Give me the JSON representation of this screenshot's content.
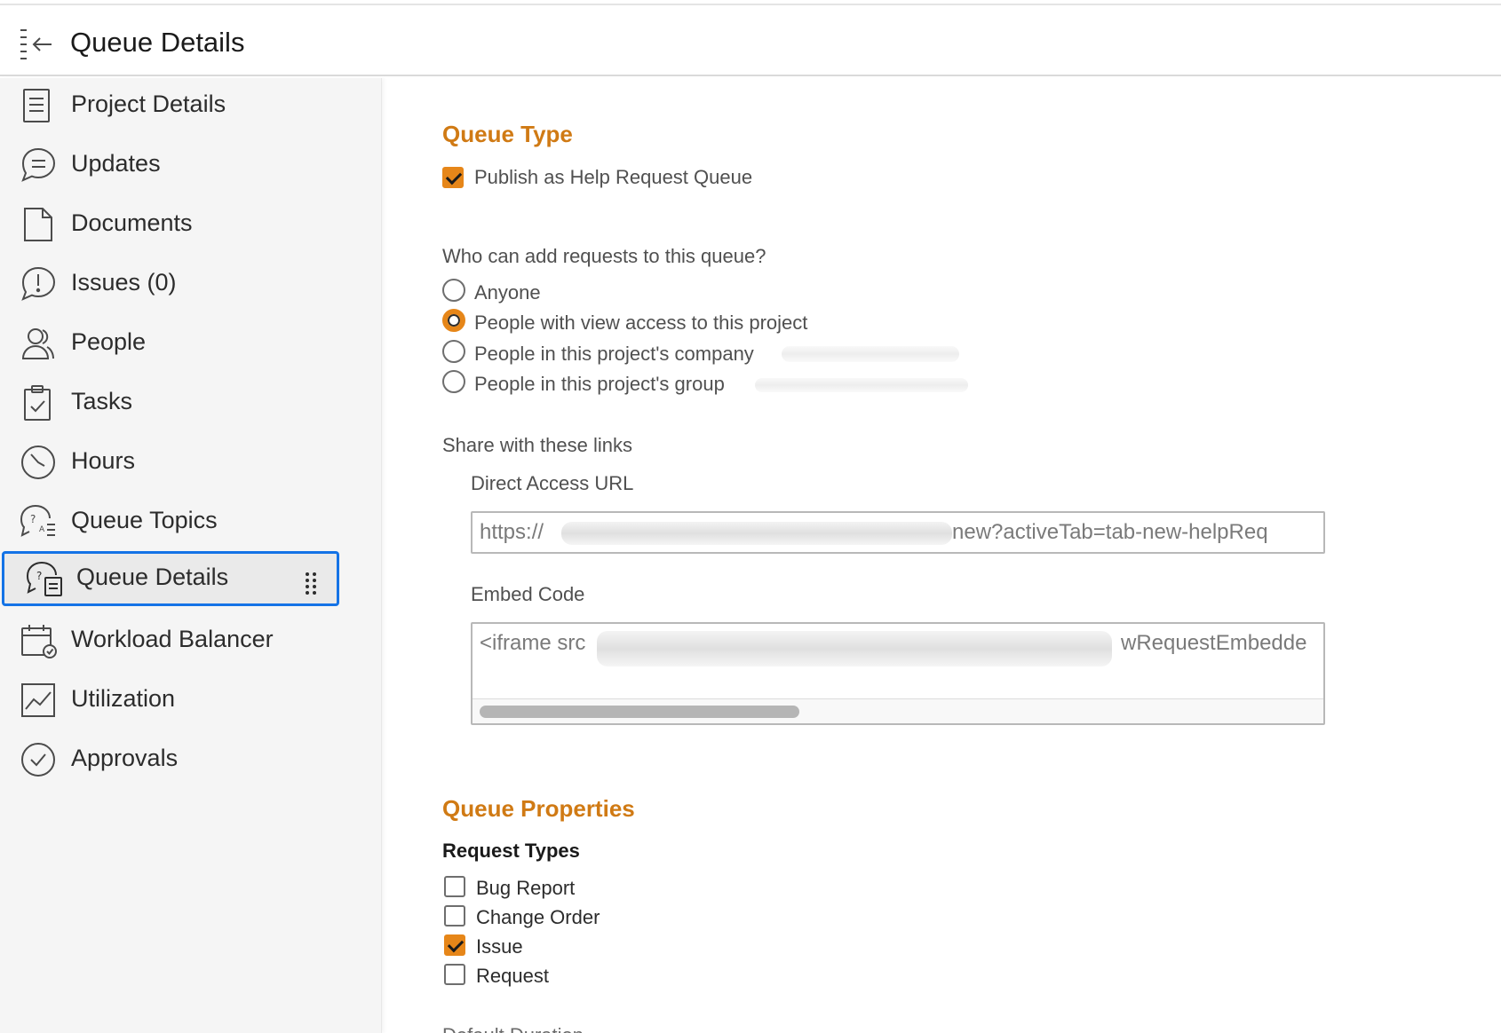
{
  "header": {
    "title": "Queue Details"
  },
  "sidebar": {
    "items": [
      {
        "label": "Project Details",
        "icon": "document-lines-icon"
      },
      {
        "label": "Updates",
        "icon": "chat-bubble-icon"
      },
      {
        "label": "Documents",
        "icon": "file-icon"
      },
      {
        "label": "Issues (0)",
        "icon": "alert-bubble-icon"
      },
      {
        "label": "People",
        "icon": "people-icon"
      },
      {
        "label": "Tasks",
        "icon": "clipboard-check-icon"
      },
      {
        "label": "Hours",
        "icon": "clock-icon"
      },
      {
        "label": "Queue Topics",
        "icon": "queue-topics-icon"
      },
      {
        "label": "Queue Details",
        "icon": "queue-details-icon",
        "active": true
      },
      {
        "label": "Workload Balancer",
        "icon": "calendar-check-icon"
      },
      {
        "label": "Utilization",
        "icon": "line-chart-icon"
      },
      {
        "label": "Approvals",
        "icon": "check-circle-icon"
      }
    ]
  },
  "queue_type": {
    "title": "Queue Type",
    "publish_label": "Publish as Help Request Queue",
    "publish_checked": true,
    "who_label": "Who can add requests to this queue?",
    "options": [
      {
        "label": "Anyone",
        "checked": false
      },
      {
        "label": "People with view access to this project",
        "checked": true
      },
      {
        "label": "People in this project's company",
        "checked": false
      },
      {
        "label": "People in this project's group",
        "checked": false
      }
    ],
    "share_label": "Share with these links",
    "direct_url_label": "Direct Access URL",
    "direct_url_start": "https://",
    "direct_url_end": "new?activeTab=tab-new-helpReq",
    "embed_label": "Embed Code",
    "embed_start": "<iframe src",
    "embed_end": "wRequestEmbedde"
  },
  "queue_properties": {
    "title": "Queue Properties",
    "request_types_label": "Request Types",
    "request_types": [
      {
        "label": "Bug Report",
        "checked": false
      },
      {
        "label": "Change Order",
        "checked": false
      },
      {
        "label": "Issue",
        "checked": true
      },
      {
        "label": "Request",
        "checked": false
      }
    ],
    "partial_label": "Default Duration"
  },
  "colors": {
    "accent": "#e68619",
    "heading": "#d07a14",
    "focus": "#1473e6"
  }
}
